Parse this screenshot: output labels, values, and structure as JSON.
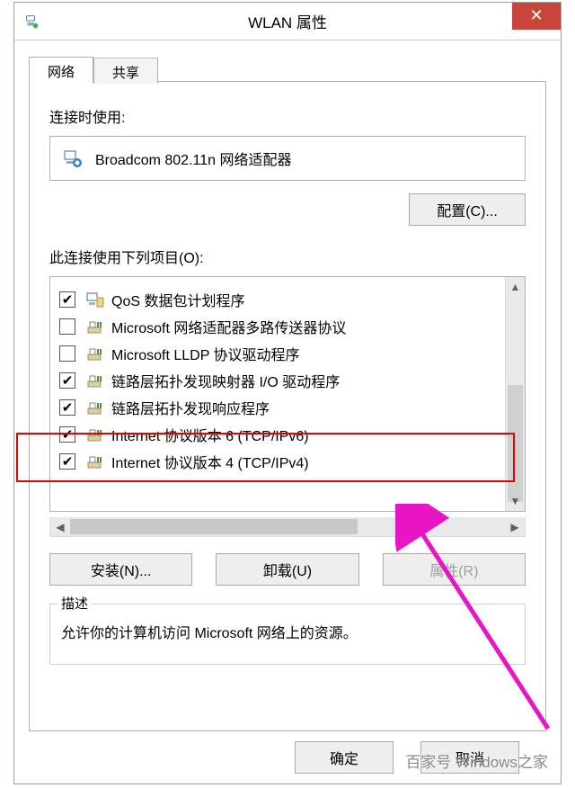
{
  "window": {
    "title": "WLAN 属性"
  },
  "tabs": {
    "network": "网络",
    "share": "共享"
  },
  "labels": {
    "adapter_label": "连接时使用:",
    "items_label": "此连接使用下列项目(O):",
    "desc_legend": "描述"
  },
  "adapter": {
    "name": "Broadcom 802.11n 网络适配器"
  },
  "buttons": {
    "configure": "配置(C)...",
    "install": "安装(N)...",
    "uninstall": "卸载(U)",
    "properties": "属性(R)",
    "ok": "确定",
    "cancel": "取消"
  },
  "items": [
    {
      "checked": true,
      "icon": "qos",
      "label": "QoS 数据包计划程序"
    },
    {
      "checked": false,
      "icon": "proto",
      "label": "Microsoft 网络适配器多路传送器协议"
    },
    {
      "checked": false,
      "icon": "proto",
      "label": "Microsoft LLDP 协议驱动程序"
    },
    {
      "checked": true,
      "icon": "proto",
      "label": "链路层拓扑发现映射器 I/O 驱动程序"
    },
    {
      "checked": true,
      "icon": "proto",
      "label": "链路层拓扑发现响应程序"
    },
    {
      "checked": true,
      "icon": "proto",
      "label": "Internet 协议版本 6 (TCP/IPv6)"
    },
    {
      "checked": true,
      "icon": "proto",
      "label": "Internet 协议版本 4 (TCP/IPv4)"
    }
  ],
  "description": {
    "text": "允许你的计算机访问 Microsoft 网络上的资源。"
  },
  "watermark": "百家号 Windows之家"
}
